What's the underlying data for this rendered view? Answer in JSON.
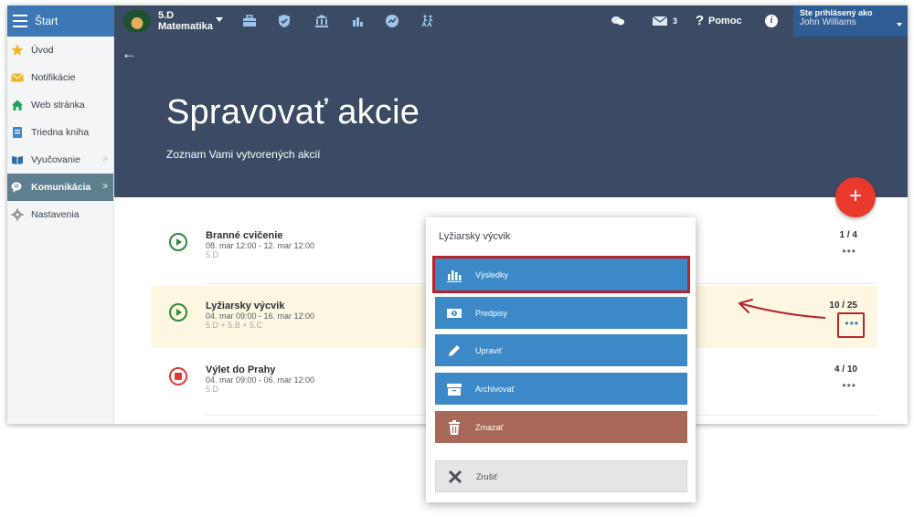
{
  "topbar": {
    "start_label": "Štart",
    "class_name": "5.D",
    "class_subject": "Matematika",
    "messages_count": "3",
    "help_label": "Pomoc",
    "info_label": "i",
    "user_label": "Ste prihlásený ako",
    "user_name": "John Williams"
  },
  "sidebar": {
    "items": [
      {
        "label": "Úvod"
      },
      {
        "label": "Notifikácie"
      },
      {
        "label": "Web stránka"
      },
      {
        "label": "Triedna kniha"
      },
      {
        "label": "Vyučovanie"
      },
      {
        "label": "Komunikácia"
      },
      {
        "label": "Nastavenia"
      }
    ]
  },
  "hero": {
    "title": "Spravovať akcie",
    "subtitle": "Zoznam Vami vytvorených akcií"
  },
  "fab_label": "+",
  "events": [
    {
      "name": "Branné cvičenie",
      "date": "08. mar 12:00 - 12. mar 12:00",
      "classes": "5.D",
      "count": "1 / 4",
      "status": "play"
    },
    {
      "name": "Lyžiarsky výcvik",
      "date": "04. mar 09:00 - 16. mar 12:00",
      "classes": "5.D + 5.B + 5.C",
      "count": "10 / 25",
      "status": "play"
    },
    {
      "name": "Výlet do Prahy",
      "date": "04. mar 09:00 - 06. mar 12:00",
      "classes": "5.D",
      "count": "4 / 10",
      "status": "stop"
    }
  ],
  "dots_label": "•••",
  "sheet": {
    "title": "Lyžiarsky výcvik",
    "actions": [
      {
        "label": "Výsledky"
      },
      {
        "label": "Predpisy"
      },
      {
        "label": "Upraviť"
      },
      {
        "label": "Archivovať"
      },
      {
        "label": "Zmazať"
      },
      {
        "label": "Zrušiť"
      }
    ]
  },
  "colors": {
    "header": "#3a4b63",
    "accent_blue": "#3d88c6",
    "delete": "#a86858",
    "fab": "#e9392d",
    "highlight": "#b8242a"
  }
}
